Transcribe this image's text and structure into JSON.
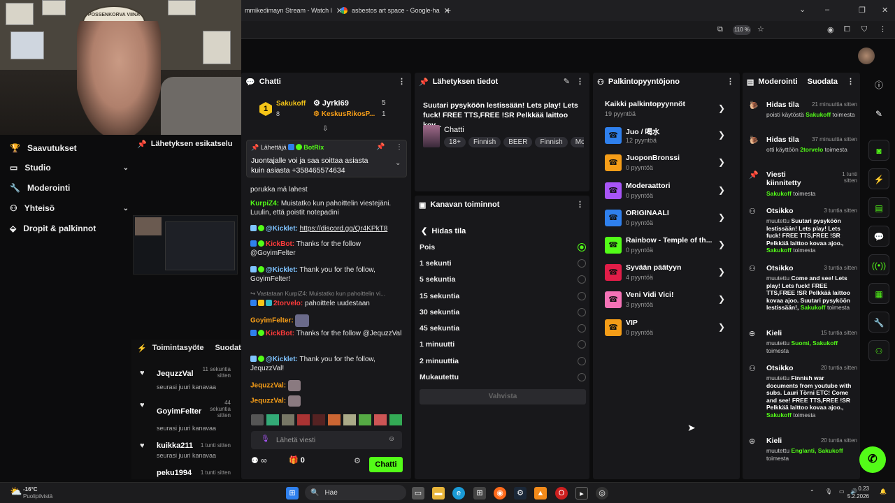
{
  "browser": {
    "tabs": [
      {
        "title": "mmikedimayn Stream - Watch l"
      },
      {
        "title": "asbestos art space - Google-ha"
      }
    ],
    "new_tab": "+",
    "zoom": "110 %"
  },
  "webcam": {
    "logo_text": "POSSENKORVA VIINA"
  },
  "nav": {
    "items": [
      {
        "label": "Saavutukset"
      },
      {
        "label": "Studio"
      },
      {
        "label": "Moderointi"
      },
      {
        "label": "Yhteisö"
      },
      {
        "label": "Dropit & palkinnot"
      }
    ]
  },
  "preview": {
    "title": "Lähetyksen esikatselu"
  },
  "activity": {
    "title": "Toimintasyöte",
    "filter": "Suodata",
    "items": [
      {
        "name": "JequzzVal",
        "time": "11 sekuntia sitten",
        "sub": "seurasi juuri kanavaa"
      },
      {
        "name": "GoyimFelter",
        "time": "44 sekuntia sitten",
        "sub": "seurasi juuri kanavaa"
      },
      {
        "name": "kuikka211",
        "time": "1 tunti sitten",
        "sub": "seurasi juuri kanavaa"
      },
      {
        "name": "peku1994",
        "time": "1 tunti sitten",
        "sub": ""
      }
    ]
  },
  "chat": {
    "title": "Chatti",
    "leaders": [
      {
        "rank": "1",
        "name": "Sakukoff",
        "count": "8"
      },
      {
        "name": "Jyrki69",
        "count": "5"
      },
      {
        "name": "KeskusRikosP...",
        "count": "1"
      }
    ],
    "pinned": {
      "label": "Lähettäjä",
      "user": "BotRix",
      "text": "Juontajalle voi ja saa soittaa asiasta kuin asiasta +358465574634"
    },
    "messages": [
      {
        "user": "",
        "text": "porukka mä lahest"
      },
      {
        "user": "KurpiZ4:",
        "text": "Muistatko kun pahoittelin viestejäni. Luulin, että poistit notepadini"
      },
      {
        "user": "@Kicklet:",
        "text": "https://discord.gg/Qr4KPkT8"
      },
      {
        "user": "KickBot:",
        "text": "Thanks for the follow @GoyimFelter"
      },
      {
        "user": "@Kicklet:",
        "text": "Thank you for the follow, GoyimFelter!"
      },
      {
        "reply": "Vastataan KurpiZ4: Muistatko kun pahoittelin vi...",
        "user": "2torvelo:",
        "text": "pahoittele uudestaan"
      },
      {
        "user": "GoyimFelter:",
        "text": ""
      },
      {
        "user": "KickBot:",
        "text": "Thanks for the follow @JequzzVal"
      },
      {
        "user": "@Kicklet:",
        "text": "Thank you for the follow, JequzzVal!"
      },
      {
        "user": "JequzzVal:",
        "text": ""
      },
      {
        "user": "JequzzVal:",
        "text": ""
      }
    ],
    "input_placeholder": "Lähetä viesti",
    "points": "0",
    "send": "Chatti"
  },
  "stream_info": {
    "title": "Lähetyksen tiedot",
    "stream_title": "Suutari pysyköön lestissään! Lets play! Lets fuck! FREE TTS,FREE !SR Pelkkää laittoo kov...",
    "category": "Chatti",
    "tags": [
      "18+",
      "Finnish",
      "BEER",
      "Finnish",
      "Mo"
    ]
  },
  "channel_actions": {
    "title": "Kanavan toiminnot",
    "back": "Hidas tila",
    "options": [
      {
        "label": "Pois",
        "selected": true
      },
      {
        "label": "1 sekunti",
        "selected": false
      },
      {
        "label": "5 sekuntia",
        "selected": false
      },
      {
        "label": "15 sekuntia",
        "selected": false
      },
      {
        "label": "30 sekuntia",
        "selected": false
      },
      {
        "label": "45 sekuntia",
        "selected": false
      },
      {
        "label": "1 minuutti",
        "selected": false
      },
      {
        "label": "2 minuuttia",
        "selected": false
      },
      {
        "label": "Mukautettu",
        "selected": false
      }
    ],
    "confirm": "Vahvista"
  },
  "rewards": {
    "title": "Palkintopyyntöjono",
    "all": {
      "name": "Kaikki palkintopyynnöt",
      "count": "19 pyyntöä"
    },
    "items": [
      {
        "name": "Juo / 喝水",
        "count": "12 pyyntöä",
        "color": "#2f80ed"
      },
      {
        "name": "JuoponBronssi",
        "count": "0 pyyntöä",
        "color": "#f59d18"
      },
      {
        "name": "Moderaattori",
        "count": "0 pyyntöä",
        "color": "#a855f7"
      },
      {
        "name": "ORIGINAALI",
        "count": "0 pyyntöä",
        "color": "#2f80ed"
      },
      {
        "name": "Rainbow - Temple of th...",
        "count": "0 pyyntöä",
        "color": "#53fc18"
      },
      {
        "name": "Syvään päätyyn",
        "count": "4 pyyntöä",
        "color": "#e11d48"
      },
      {
        "name": "Veni Vidi Vici!",
        "count": "3 pyyntöä",
        "color": "#f472b6"
      },
      {
        "name": "VIP",
        "count": "0 pyyntöä",
        "color": "#f59d18"
      }
    ]
  },
  "moderation": {
    "title": "Moderointi",
    "filter": "Suodata",
    "entries": [
      {
        "title": "Hidas tila",
        "time": "21 minuuttia sitten",
        "body": "poisti käytöstä",
        "user": "Sakukoff",
        "suffix": "toimesta"
      },
      {
        "title": "Hidas tila",
        "time": "37 minuuttia sitten",
        "body": "otti käyttöön",
        "user": "2torvelo",
        "suffix": "toimesta"
      },
      {
        "title": "Viesti kiinnitetty",
        "time": "1 tunti sitten",
        "body": "",
        "user": "Sakukoff",
        "suffix": "toimesta"
      },
      {
        "title": "Otsikko",
        "time": "3 tuntia sitten",
        "body": "muutettu",
        "bold": "Suutari pysyköön lestissään! Lets play! Lets fuck! FREE TTS,FREE !SR Pelkkää laittoo kovaa ajoo.,",
        "user": "Sakukoff",
        "suffix": "toimesta"
      },
      {
        "title": "Otsikko",
        "time": "3 tuntia sitten",
        "body": "muutettu",
        "bold": "Come and see! Lets play! Lets fuck! FREE TTS,FREE !SR Pelkkää laittoo kovaa ajoo. Suutari pysyköön lestissään!,",
        "user": "Sakukoff",
        "suffix": "toimesta"
      },
      {
        "title": "Kieli",
        "time": "15 tuntia sitten",
        "body": "muutettu",
        "bold": "Suomi,",
        "user": "Sakukoff",
        "suffix": "toimesta"
      },
      {
        "title": "Otsikko",
        "time": "20 tuntia sitten",
        "body": "muutettu",
        "bold": "Finnish war documents from youtube with subs. Lauri Törni ETC! Come and see! FREE TTS,FREE !SR Pelkkää laittoo kovaa ajoo.,",
        "user": "Sakukoff",
        "suffix": "toimesta"
      },
      {
        "title": "Kieli",
        "time": "20 tuntia sitten",
        "body": "muutettu",
        "bold": "Englanti,",
        "user": "Sakukoff",
        "suffix": "toimesta"
      }
    ]
  },
  "taskbar": {
    "weather_temp": "-16°C",
    "weather_desc": "Puolipilvistä",
    "search": "Hae",
    "time": "0.23",
    "date": "5.2.2026"
  },
  "colors": {
    "accent": "#53fc18",
    "panel": "#18181b",
    "bg": "#0c0c0d"
  }
}
